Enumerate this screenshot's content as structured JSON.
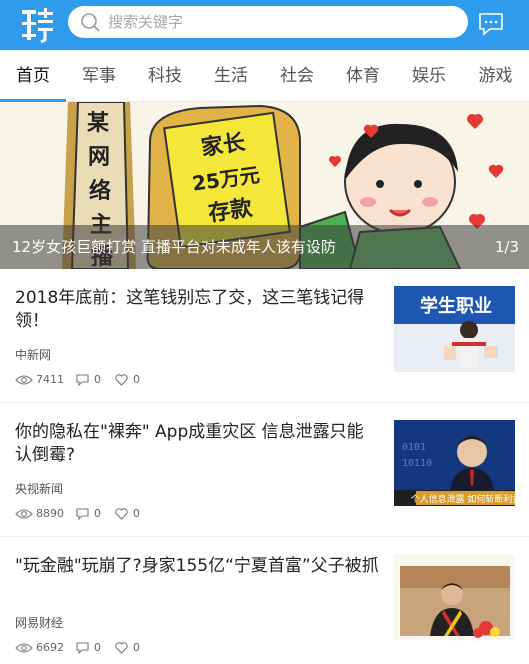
{
  "header": {
    "logo_text": "聘",
    "search_placeholder": "搜索关键字"
  },
  "tabs": [
    {
      "label": "首页",
      "active": true
    },
    {
      "label": "军事",
      "active": false
    },
    {
      "label": "科技",
      "active": false
    },
    {
      "label": "生活",
      "active": false
    },
    {
      "label": "社会",
      "active": false
    },
    {
      "label": "体育",
      "active": false
    },
    {
      "label": "娱乐",
      "active": false
    },
    {
      "label": "游戏",
      "active": false
    }
  ],
  "banner": {
    "caption": "12岁女孩巨额打赏 直播平台对未成年人该有设防",
    "index": "1/3",
    "image_text_left": "某网络主播",
    "image_text_box": "家长25万元存款"
  },
  "news": [
    {
      "title": "2018年底前：这笔钱别忘了交，这三笔钱记得领！",
      "source": "中新网",
      "views": "7411",
      "comments": "0",
      "likes": "0",
      "thumb_text": "学生职业"
    },
    {
      "title": "你的隐私在\"裸奔\" App成重灾区 信息泄露只能认倒霉?",
      "source": "央视新闻",
      "views": "8890",
      "comments": "0",
      "likes": "0",
      "thumb_text": "个人信息泄露 如何斩断利益"
    },
    {
      "title": "\"玩金融\"玩崩了?身家155亿“宁夏首富”父子被抓",
      "source": "网易财经",
      "views": "6692",
      "comments": "0",
      "likes": "0",
      "thumb_text": ""
    }
  ],
  "colors": {
    "accent": "#2f9bec",
    "text": "#222222",
    "muted": "#666666"
  }
}
